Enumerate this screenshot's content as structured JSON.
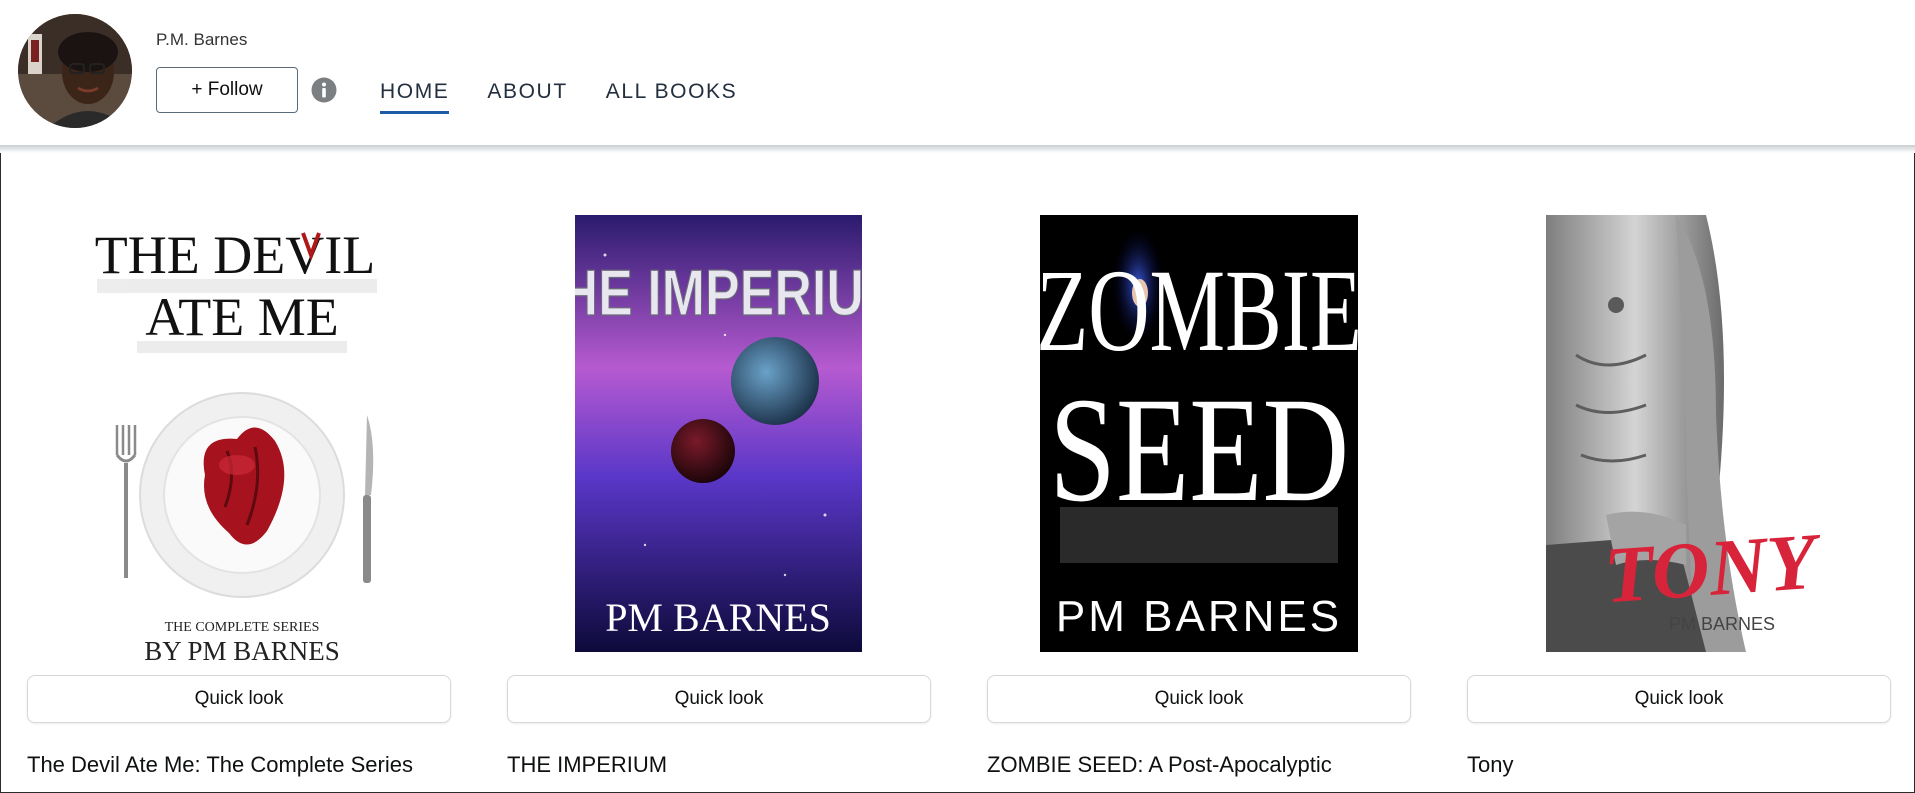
{
  "author": {
    "name": "P.M. Barnes",
    "follow_label": "+ Follow"
  },
  "icons": {
    "info": "info-icon",
    "avatar": "author-avatar"
  },
  "nav": {
    "items": [
      {
        "label": "HOME",
        "active": true
      },
      {
        "label": "ABOUT",
        "active": false
      },
      {
        "label": "ALL BOOKS",
        "active": false
      }
    ]
  },
  "books": [
    {
      "title": "The Devil Ate Me: The Complete Series",
      "quick_look": "Quick look",
      "cover": {
        "title_line1": "THE DEVIL",
        "title_line2": "ATE ME",
        "subtitle": "THE COMPLETE SERIES",
        "author": "BY PM BARNES"
      }
    },
    {
      "title": "THE IMPERIUM",
      "quick_look": "Quick look",
      "cover": {
        "title": "THE IMPERIUM",
        "author": "PM BARNES"
      }
    },
    {
      "title": "ZOMBIE SEED: A Post-Apocalyptic",
      "quick_look": "Quick look",
      "cover": {
        "title_line1": "ZOMBIE",
        "title_line2": "SEED",
        "author": "PM BARNES"
      }
    },
    {
      "title": "Tony",
      "quick_look": "Quick look",
      "cover": {
        "title": "TONY",
        "author": "PM BARNES"
      }
    }
  ],
  "colors": {
    "nav_underline": "#1f5aa6",
    "nav_text": "#232f3e",
    "button_border": "#d5d9d9",
    "devil_red": "#b01818",
    "tony_red": "#d8243a"
  }
}
